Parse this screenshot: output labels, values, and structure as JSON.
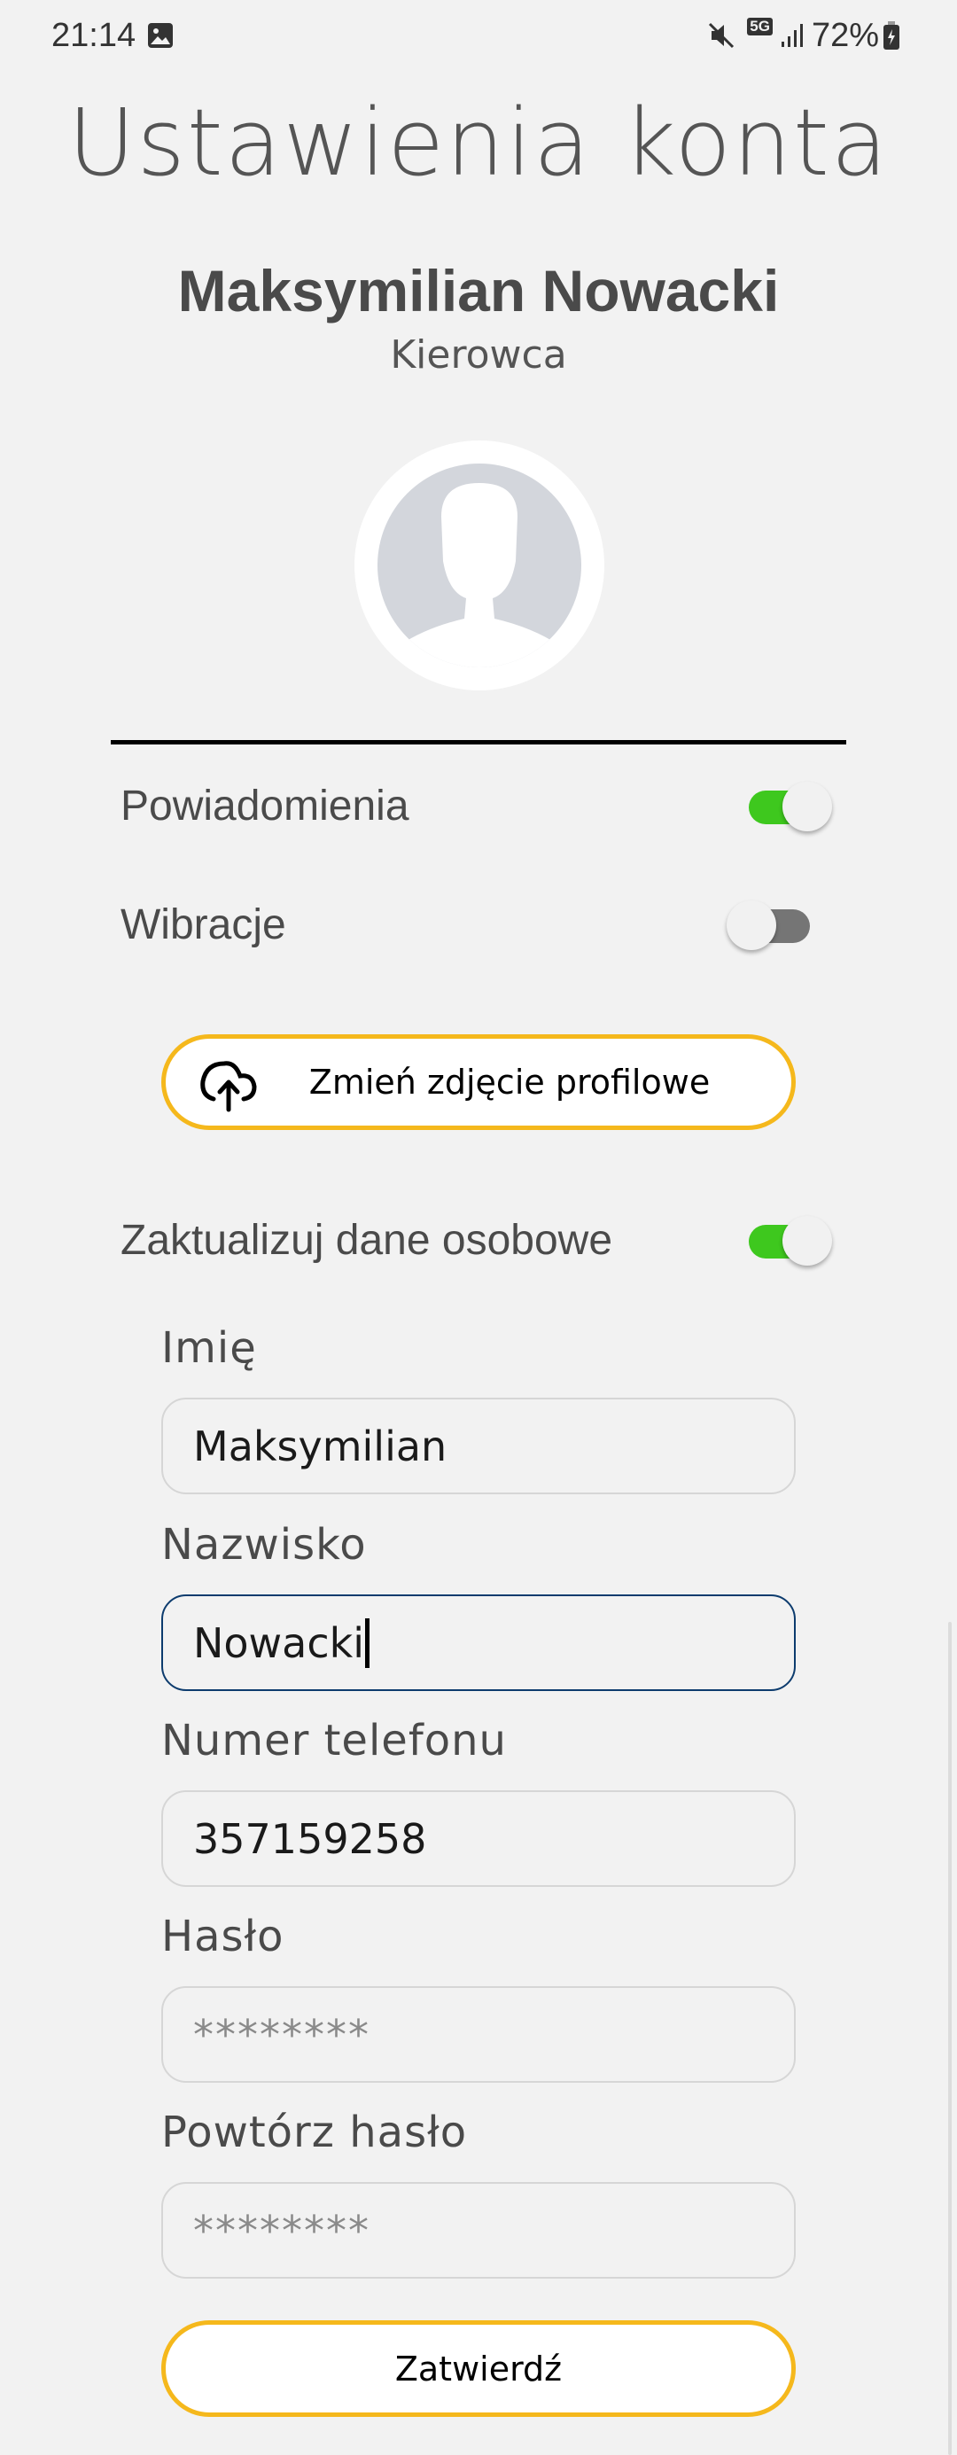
{
  "status_bar": {
    "time": "21:14",
    "network": "5G",
    "battery": "72%",
    "icons": [
      "gallery-icon",
      "mute-icon",
      "5g-icon",
      "signal-icon",
      "battery-charging-icon"
    ]
  },
  "page": {
    "title": "Ustawienia konta"
  },
  "profile": {
    "name": "Maksymilian Nowacki",
    "role": "Kierowca",
    "avatar_icon": "person-silhouette-icon"
  },
  "settings": [
    {
      "label": "Powiadomienia",
      "on": true
    },
    {
      "label": "Wibracje",
      "on": false
    }
  ],
  "change_photo": {
    "label": "Zmień zdjęcie profilowe",
    "icon": "cloud-upload-icon"
  },
  "update_toggle": {
    "label": "Zaktualizuj dane osobowe",
    "on": true
  },
  "form": {
    "first_name": {
      "label": "Imię",
      "value": "Maksymilian"
    },
    "last_name": {
      "label": "Nazwisko",
      "value": "Nowacki"
    },
    "phone": {
      "label": "Numer telefonu",
      "value": "357159258"
    },
    "password": {
      "label": "Hasło",
      "placeholder": "********"
    },
    "password_repeat": {
      "label": "Powtórz hasło",
      "placeholder": "********"
    },
    "submit_label": "Zatwierdź"
  },
  "colors": {
    "accent": "#f5b81c",
    "toggle_on": "#3ec81e",
    "toggle_off": "#757575",
    "focus_border": "#0d3c6e"
  }
}
